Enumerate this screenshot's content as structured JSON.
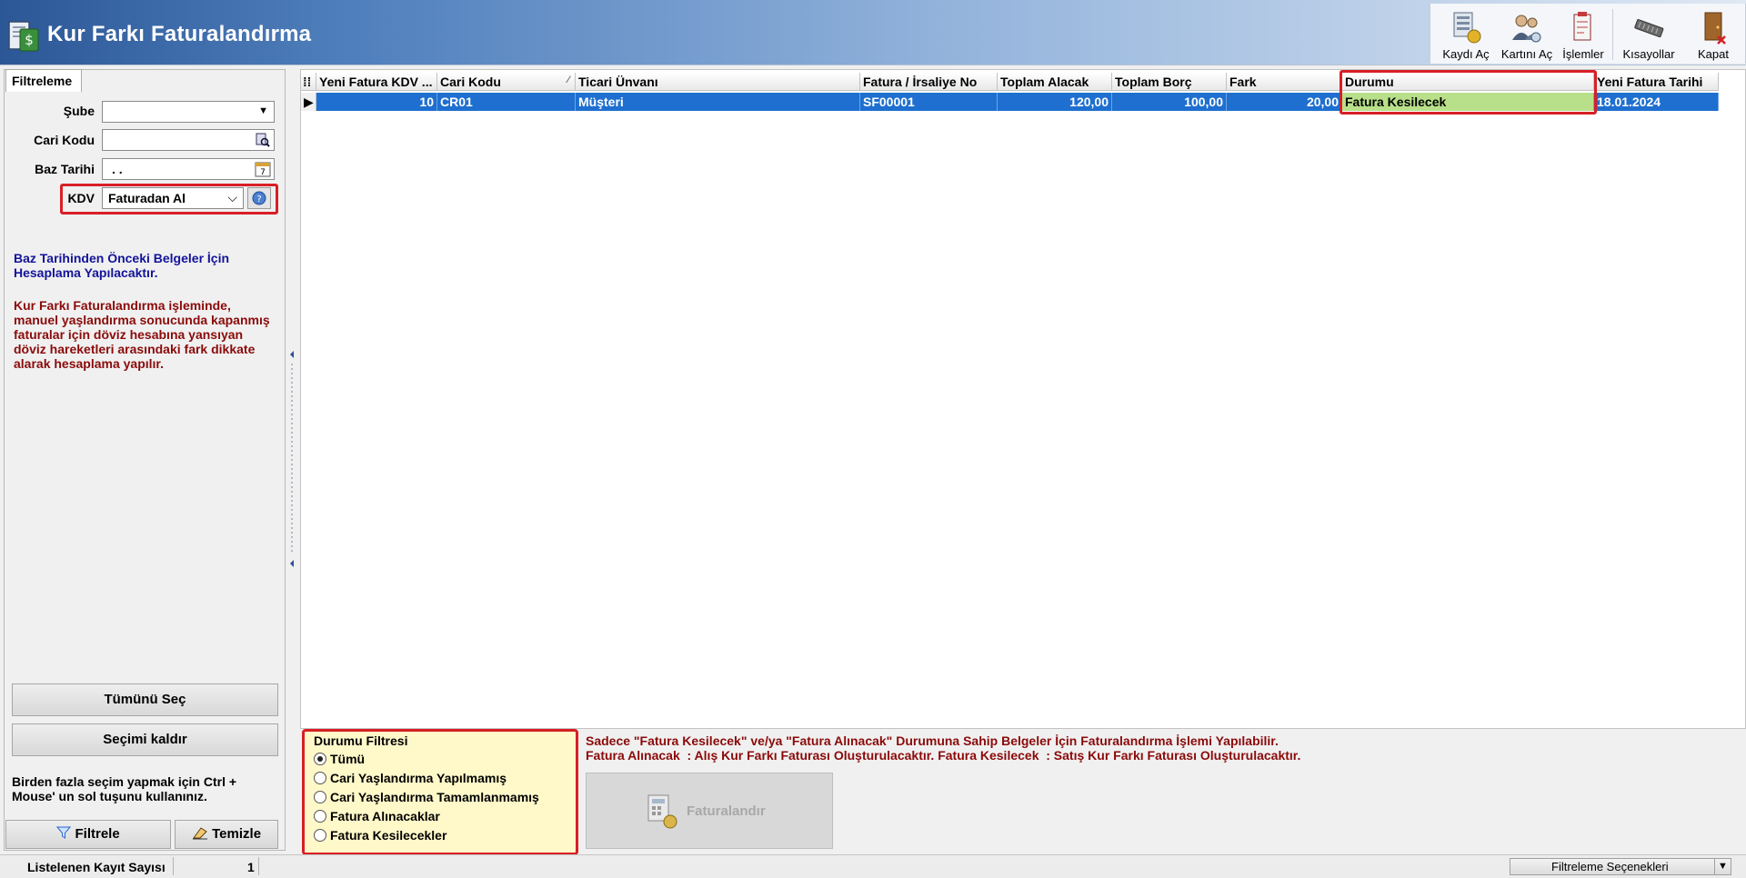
{
  "header": {
    "title": "Kur Farkı Faturalandırma",
    "toolbar": [
      {
        "label": "Kaydı Aç",
        "icon": "open-record-icon"
      },
      {
        "label": "Kartını Aç",
        "icon": "open-card-icon"
      },
      {
        "label": "İşlemler",
        "icon": "operations-icon"
      },
      {
        "label": "Kısayollar",
        "icon": "shortcuts-icon"
      },
      {
        "label": "Kapat",
        "icon": "close-door-icon"
      }
    ]
  },
  "left": {
    "tab": "Filtreleme",
    "fields": {
      "sube_label": "Şube",
      "sube_value": "",
      "cari_label": "Cari Kodu",
      "cari_value": "",
      "baz_label": "Baz Tarihi",
      "baz_value": ". .",
      "kdv_label": "KDV",
      "kdv_value": "Faturadan Al"
    },
    "note_blue": "Baz Tarihinden Önceki Belgeler İçin Hesaplama Yapılacaktır.",
    "note_red": "Kur Farkı Faturalandırma işleminde, manuel yaşlandırma sonucunda kapanmış faturalar için döviz hesabına yansıyan döviz hareketleri arasındaki fark dikkate alarak hesaplama yapılır.",
    "select_all": "Tümünü Seç",
    "clear_selection": "Seçimi kaldır",
    "hint": "Birden fazla seçim yapmak için Ctrl + Mouse' un sol tuşunu kullanınız.",
    "filter_button": "Filtrele",
    "clear_button": "Temizle"
  },
  "grid": {
    "columns": [
      "Yeni Fatura KDV ...",
      "Cari Kodu",
      "Ticari Ünvanı",
      "Fatura / İrsaliye No",
      "Toplam Alacak",
      "Toplam Borç",
      "Fark",
      "Durumu",
      "Yeni Fatura Tarihi"
    ],
    "rows": [
      {
        "kdv": "10",
        "cari_kodu": "CR01",
        "unvan": "Müşteri",
        "fatura_no": "SF00001",
        "alacak": "120,00",
        "borc": "100,00",
        "fark": "20,00",
        "durum": "Fatura Kesilecek",
        "tarih": "18.01.2024"
      }
    ]
  },
  "durum_filter": {
    "title": "Durumu Filtresi",
    "options": [
      "Tümü",
      "Cari Yaşlandırma Yapılmamış",
      "Cari Yaşlandırma Tamamlanmamış",
      "Fatura Alınacaklar",
      "Fatura Kesilecekler"
    ],
    "selected": "Tümü"
  },
  "info": {
    "line1": "Sadece \"Fatura Kesilecek\" ve/ya \"Fatura Alınacak\" Durumuna Sahip Belgeler İçin Faturalandırma İşlemi Yapılabilir.",
    "line2": "Fatura Alınacak  : Alış Kur Farkı Faturası Oluşturulacaktır. Fatura Kesilecek  : Satış Kur Farkı Faturası Oluşturulacaktır."
  },
  "invoice_button": "Faturalandır",
  "status": {
    "count_label": "Listelenen Kayıt Sayısı",
    "count_value": "1",
    "filter_options": "Filtreleme Seçenekleri"
  },
  "colors": {
    "selection": "#1e6fd0",
    "durum_cell": "#b8e08a",
    "highlight": "#d81f26",
    "note_blue": "#13139a",
    "note_red": "#8b0a0a"
  }
}
